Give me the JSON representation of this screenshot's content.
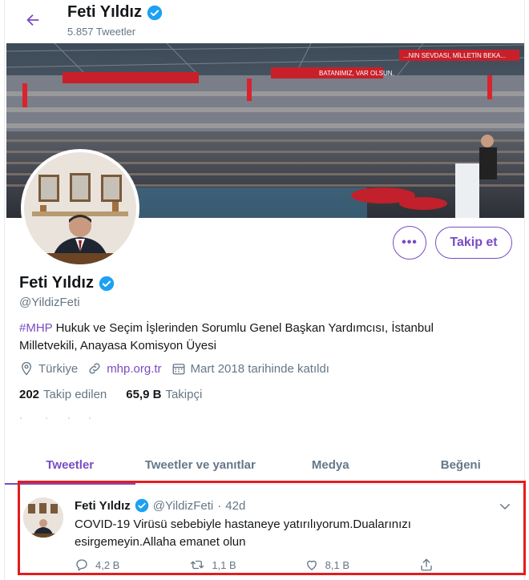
{
  "header": {
    "name": "Feti Yıldız",
    "tweet_count": "5.857 Tweetler"
  },
  "banner": {
    "sign_text": "...NIN SEVDASI, MİLLETİN BEKA...",
    "sign_text_2": "BATANIMIZ, VAR OLSUN."
  },
  "profile": {
    "name": "Feti Yıldız",
    "handle": "@YildizFeti",
    "bio_hashtag": "#MHP",
    "bio_text": " Hukuk ve Seçim İşlerinden Sorumlu Genel Başkan Yardımcısı, İstanbul Milletvekili, Anayasa Komisyon Üyesi",
    "location": "Türkiye",
    "website": "mhp.org.tr",
    "joined": "Mart 2018 tarihinde katıldı",
    "following_count": "202",
    "following_label": "Takip edilen",
    "followers_count": "65,9 B",
    "followers_label": "Takipçi"
  },
  "actions": {
    "more_label": "•••",
    "follow_label": "Takip et"
  },
  "tabs": [
    {
      "label": "Tweetler",
      "active": true
    },
    {
      "label": "Tweetler ve yanıtlar",
      "active": false
    },
    {
      "label": "Medya",
      "active": false
    },
    {
      "label": "Beğeni",
      "active": false
    }
  ],
  "tweet": {
    "name": "Feti Yıldız",
    "handle": "@YildizFeti",
    "separator": "·",
    "time": "42d",
    "text": "COVID-19 Virüsü sebebiyle hastaneye yatırılıyorum.Dualarınızı esirgemeyin.Allaha emanet olun",
    "replies": "4,2 B",
    "retweets": "1,1 B",
    "likes": "8,1 B"
  },
  "colors": {
    "accent": "#794bc4",
    "verified": "#1da1f2",
    "highlight_border": "#e11d1d",
    "secondary_text": "#657786"
  }
}
